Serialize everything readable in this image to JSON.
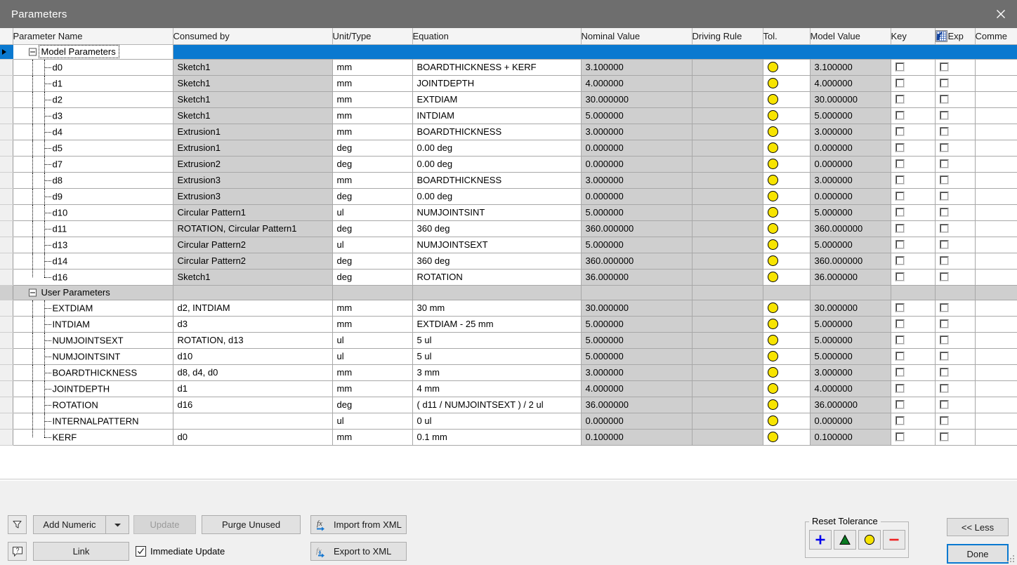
{
  "window": {
    "title": "Parameters",
    "close_icon": "close-icon"
  },
  "grid": {
    "columns": [
      "Parameter Name",
      "Consumed by",
      "Unit/Type",
      "Equation",
      "Nominal Value",
      "Driving Rule",
      "Tol.",
      "Model Value",
      "Key",
      "Exp",
      "Comme"
    ],
    "groups": [
      {
        "label": "Model Parameters",
        "selected": true,
        "rows": [
          {
            "name": "d0",
            "consumed": "Sketch1",
            "unit": "mm",
            "equation": "BOARDTHICKNESS + KERF",
            "nominal": "3.100000",
            "driving": "",
            "tol": "yellow",
            "model": "3.100000",
            "key": false,
            "exp": false,
            "comment": ""
          },
          {
            "name": "d1",
            "consumed": "Sketch1",
            "unit": "mm",
            "equation": "JOINTDEPTH",
            "nominal": "4.000000",
            "driving": "",
            "tol": "yellow",
            "model": "4.000000",
            "key": false,
            "exp": false,
            "comment": ""
          },
          {
            "name": "d2",
            "consumed": "Sketch1",
            "unit": "mm",
            "equation": "EXTDIAM",
            "nominal": "30.000000",
            "driving": "",
            "tol": "yellow",
            "model": "30.000000",
            "key": false,
            "exp": false,
            "comment": ""
          },
          {
            "name": "d3",
            "consumed": "Sketch1",
            "unit": "mm",
            "equation": "INTDIAM",
            "nominal": "5.000000",
            "driving": "",
            "tol": "yellow",
            "model": "5.000000",
            "key": false,
            "exp": false,
            "comment": ""
          },
          {
            "name": "d4",
            "consumed": "Extrusion1",
            "unit": "mm",
            "equation": "BOARDTHICKNESS",
            "nominal": "3.000000",
            "driving": "",
            "tol": "yellow",
            "model": "3.000000",
            "key": false,
            "exp": false,
            "comment": ""
          },
          {
            "name": "d5",
            "consumed": "Extrusion1",
            "unit": "deg",
            "equation": "0.00 deg",
            "nominal": "0.000000",
            "driving": "",
            "tol": "yellow",
            "model": "0.000000",
            "key": false,
            "exp": false,
            "comment": ""
          },
          {
            "name": "d7",
            "consumed": "Extrusion2",
            "unit": "deg",
            "equation": "0.00 deg",
            "nominal": "0.000000",
            "driving": "",
            "tol": "yellow",
            "model": "0.000000",
            "key": false,
            "exp": false,
            "comment": ""
          },
          {
            "name": "d8",
            "consumed": "Extrusion3",
            "unit": "mm",
            "equation": "BOARDTHICKNESS",
            "nominal": "3.000000",
            "driving": "",
            "tol": "yellow",
            "model": "3.000000",
            "key": false,
            "exp": false,
            "comment": ""
          },
          {
            "name": "d9",
            "consumed": "Extrusion3",
            "unit": "deg",
            "equation": "0.00 deg",
            "nominal": "0.000000",
            "driving": "",
            "tol": "yellow",
            "model": "0.000000",
            "key": false,
            "exp": false,
            "comment": ""
          },
          {
            "name": "d10",
            "consumed": "Circular Pattern1",
            "unit": "ul",
            "equation": "NUMJOINTSINT",
            "nominal": "5.000000",
            "driving": "",
            "tol": "yellow",
            "model": "5.000000",
            "key": false,
            "exp": false,
            "comment": ""
          },
          {
            "name": "d11",
            "consumed": "ROTATION, Circular Pattern1",
            "unit": "deg",
            "equation": "360 deg",
            "nominal": "360.000000",
            "driving": "",
            "tol": "yellow",
            "model": "360.000000",
            "key": false,
            "exp": false,
            "comment": ""
          },
          {
            "name": "d13",
            "consumed": "Circular Pattern2",
            "unit": "ul",
            "equation": "NUMJOINTSEXT",
            "nominal": "5.000000",
            "driving": "",
            "tol": "yellow",
            "model": "5.000000",
            "key": false,
            "exp": false,
            "comment": ""
          },
          {
            "name": "d14",
            "consumed": "Circular Pattern2",
            "unit": "deg",
            "equation": "360 deg",
            "nominal": "360.000000",
            "driving": "",
            "tol": "yellow",
            "model": "360.000000",
            "key": false,
            "exp": false,
            "comment": ""
          },
          {
            "name": "d16",
            "consumed": "Sketch1",
            "unit": "deg",
            "equation": "ROTATION",
            "nominal": "36.000000",
            "driving": "",
            "tol": "yellow",
            "model": "36.000000",
            "key": false,
            "exp": false,
            "comment": ""
          }
        ]
      },
      {
        "label": "User Parameters",
        "selected": false,
        "rows": [
          {
            "name": "EXTDIAM",
            "consumed": "d2, INTDIAM",
            "unit": "mm",
            "equation": "30 mm",
            "nominal": "30.000000",
            "driving": "",
            "tol": "yellow",
            "model": "30.000000",
            "key": false,
            "exp": false,
            "comment": ""
          },
          {
            "name": "INTDIAM",
            "consumed": "d3",
            "unit": "mm",
            "equation": "EXTDIAM - 25 mm",
            "nominal": "5.000000",
            "driving": "",
            "tol": "yellow",
            "model": "5.000000",
            "key": false,
            "exp": false,
            "comment": ""
          },
          {
            "name": "NUMJOINTSEXT",
            "consumed": "ROTATION, d13",
            "unit": "ul",
            "equation": "5 ul",
            "nominal": "5.000000",
            "driving": "",
            "tol": "yellow",
            "model": "5.000000",
            "key": false,
            "exp": false,
            "comment": ""
          },
          {
            "name": "NUMJOINTSINT",
            "consumed": "d10",
            "unit": "ul",
            "equation": "5 ul",
            "nominal": "5.000000",
            "driving": "",
            "tol": "yellow",
            "model": "5.000000",
            "key": false,
            "exp": false,
            "comment": ""
          },
          {
            "name": "BOARDTHICKNESS",
            "consumed": "d8, d4, d0",
            "unit": "mm",
            "equation": "3 mm",
            "nominal": "3.000000",
            "driving": "",
            "tol": "yellow",
            "model": "3.000000",
            "key": false,
            "exp": false,
            "comment": ""
          },
          {
            "name": "JOINTDEPTH",
            "consumed": "d1",
            "unit": "mm",
            "equation": "4 mm",
            "nominal": "4.000000",
            "driving": "",
            "tol": "yellow",
            "model": "4.000000",
            "key": false,
            "exp": false,
            "comment": ""
          },
          {
            "name": "ROTATION",
            "consumed": "d16",
            "unit": "deg",
            "equation": "( d11 / NUMJOINTSEXT ) / 2 ul",
            "nominal": "36.000000",
            "driving": "",
            "tol": "yellow",
            "model": "36.000000",
            "key": false,
            "exp": false,
            "comment": ""
          },
          {
            "name": "INTERNALPATTERN",
            "consumed": "",
            "unit": "ul",
            "equation": "0 ul",
            "nominal": "0.000000",
            "driving": "",
            "tol": "yellow",
            "model": "0.000000",
            "key": false,
            "exp": false,
            "comment": ""
          },
          {
            "name": "KERF",
            "consumed": "d0",
            "unit": "mm",
            "equation": "0.1 mm",
            "nominal": "0.100000",
            "driving": "",
            "tol": "yellow",
            "model": "0.100000",
            "key": false,
            "exp": false,
            "comment": ""
          }
        ]
      }
    ]
  },
  "toolbar": {
    "filter_icon": "filter-icon",
    "help_icon": "help-icon",
    "add_numeric_label": "Add Numeric",
    "add_numeric_dropdown_icon": "chevron-down-icon",
    "update_label": "Update",
    "update_enabled": false,
    "purge_unused_label": "Purge Unused",
    "import_xml_label": "Import from XML",
    "export_xml_label": "Export to XML",
    "link_label": "Link",
    "immediate_update_label": "Immediate Update",
    "immediate_update_checked": true,
    "reset_tolerance_label": "Reset Tolerance",
    "reset_tolerance_buttons": [
      {
        "name": "plus-icon",
        "glyph": "plus",
        "color": "#0000ee"
      },
      {
        "name": "triangle-icon",
        "glyph": "triangle",
        "color": "#0a7a22"
      },
      {
        "name": "circle-icon",
        "glyph": "circle",
        "color": "#f7e400"
      },
      {
        "name": "minus-icon",
        "glyph": "minus",
        "color": "#ee2222"
      }
    ],
    "less_label": "<< Less",
    "done_label": "Done"
  },
  "colors": {
    "selection_blue": "#0a79d0",
    "titlebar_gray": "#6e6e6e",
    "row_gray": "#cfcfcf",
    "tolerance_yellow": "#f7e400"
  }
}
